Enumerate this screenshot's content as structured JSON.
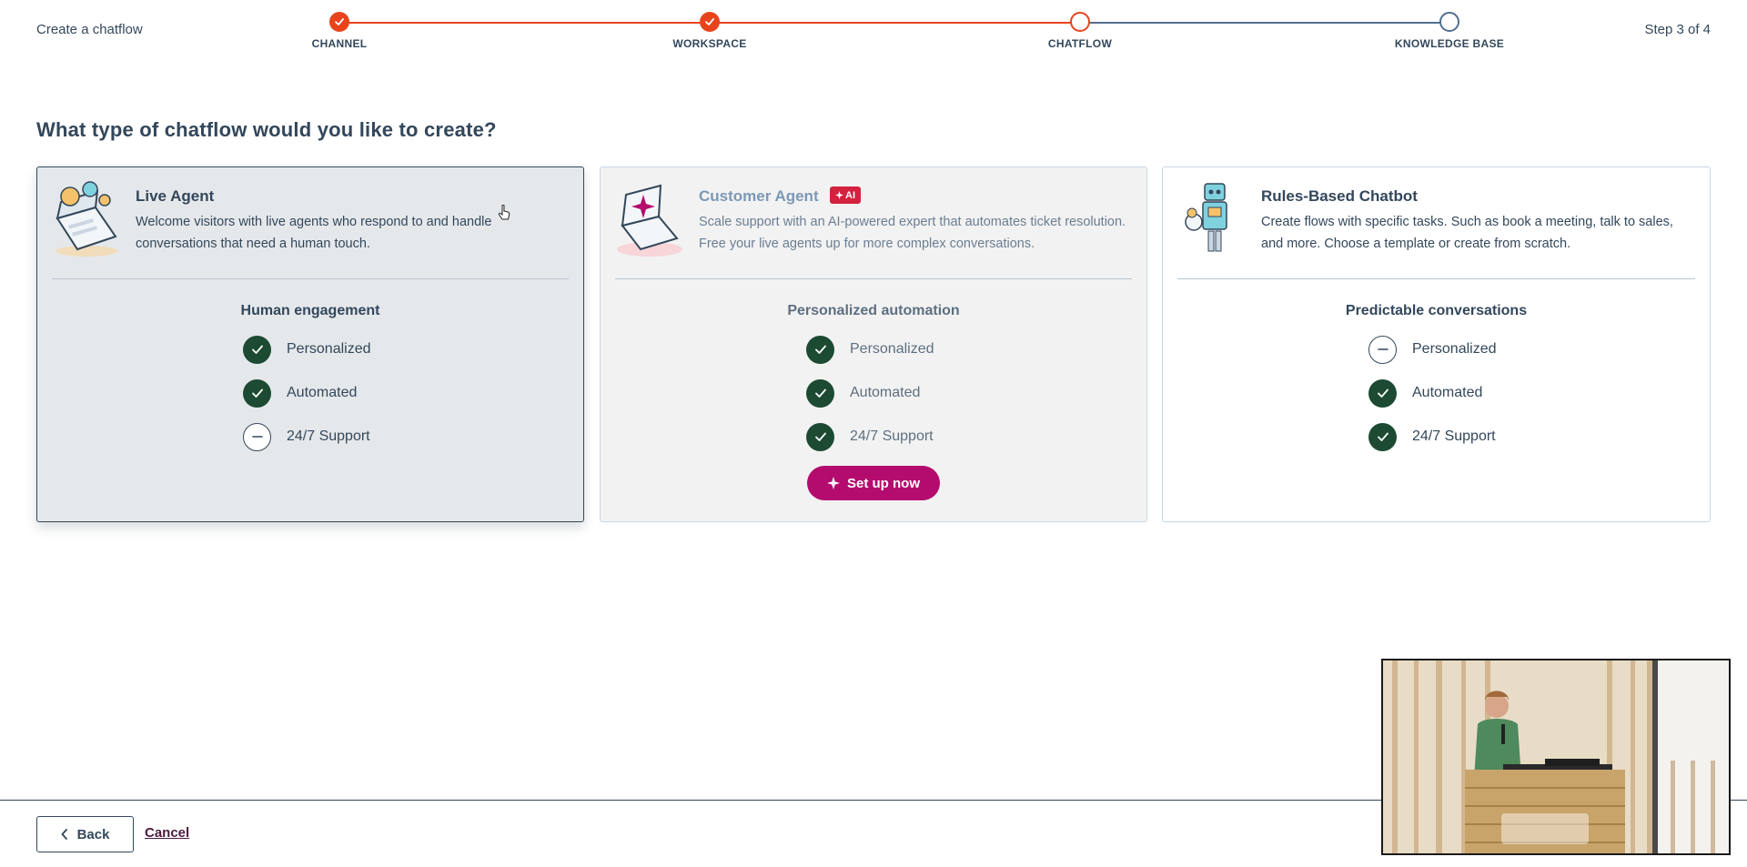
{
  "header": {
    "page_label": "Create a chatflow",
    "step_count": "Step 3 of 4",
    "steps": [
      {
        "label": "CHANNEL",
        "state": "done"
      },
      {
        "label": "WORKSPACE",
        "state": "done"
      },
      {
        "label": "CHATFLOW",
        "state": "current"
      },
      {
        "label": "KNOWLEDGE BASE",
        "state": "todo"
      }
    ]
  },
  "question": "What type of chatflow would you like to create?",
  "cards": [
    {
      "title": "Live Agent",
      "description": "Welcome visitors with live agents who respond to and handle conversations that need a human touch.",
      "subheading": "Human engagement",
      "state": "selected",
      "features": [
        {
          "label": "Personalized",
          "included": true
        },
        {
          "label": "Automated",
          "included": true
        },
        {
          "label": "24/7 Support",
          "included": false
        }
      ]
    },
    {
      "title": "Customer Agent",
      "badge": "AI",
      "description": "Scale support with an AI-powered expert that automates ticket resolution. Free your live agents up for more complex conversations.",
      "subheading": "Personalized automation",
      "state": "disabled",
      "features": [
        {
          "label": "Personalized",
          "included": true
        },
        {
          "label": "Automated",
          "included": true
        },
        {
          "label": "24/7 Support",
          "included": true
        }
      ],
      "button_label": "Set up now"
    },
    {
      "title": "Rules-Based Chatbot",
      "description": "Create flows with specific tasks. Such as book a meeting, talk to sales, and more. Choose a template or create from scratch.",
      "subheading": "Predictable conversations",
      "state": "default",
      "features": [
        {
          "label": "Personalized",
          "included": false
        },
        {
          "label": "Automated",
          "included": true
        },
        {
          "label": "24/7 Support",
          "included": true
        }
      ]
    }
  ],
  "footer": {
    "back_label": "Back",
    "cancel_label": "Cancel"
  },
  "colors": {
    "accent_orange": "#e8441c",
    "selected_bg": "#e5e8eb",
    "check_green": "#1c4a32",
    "ai_badge": "#d3213e",
    "setup_button": "#b30c6e"
  },
  "icons": [
    "check-icon",
    "dash-icon",
    "sparkle-icon",
    "chevron-left-icon",
    "pointer-cursor-icon"
  ]
}
